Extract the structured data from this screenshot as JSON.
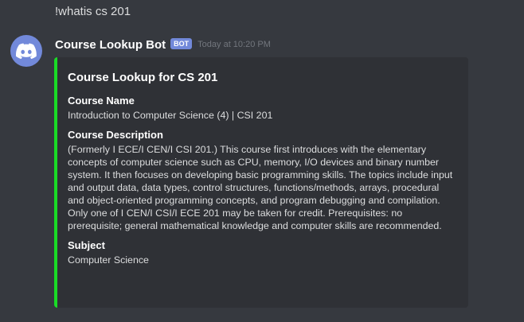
{
  "previous_message": {
    "text": "!whatis cs 201"
  },
  "message": {
    "avatar_icon": "discord-logo-icon",
    "author": "Course Lookup Bot",
    "bot_tag": "BOT",
    "timestamp": "Today at 10:20 PM",
    "embed": {
      "accent_color": "#1adb26",
      "title": "Course Lookup for CS 201",
      "fields": [
        {
          "name": "Course Name",
          "value": "Introduction to Computer Science (4) | CSI 201"
        },
        {
          "name": "Course Description",
          "value": "(Formerly I ECE/I CEN/I CSI 201.) This course first introduces with the elementary concepts of computer science such as CPU, memory, I/O devices and binary number system. It then focuses on developing basic programming skills. The topics include input and output data, data types, control structures, functions/methods, arrays, procedural and object-oriented programming concepts, and program debugging and compilation. Only one of I CEN/I CSI/I ECE 201 may be taken for credit. Prerequisites: no prerequisite; general mathematical knowledge and computer skills are recommended."
        },
        {
          "name": "Subject",
          "value": "Computer Science"
        }
      ]
    }
  },
  "colors": {
    "background": "#36393f",
    "embed_background": "#2f3136",
    "bot_tag": "#7289da",
    "timestamp": "#72767d"
  }
}
